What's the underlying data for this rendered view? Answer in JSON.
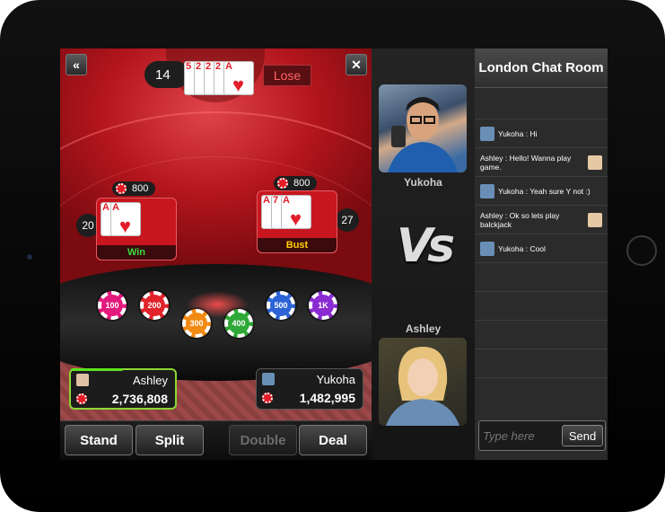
{
  "game": {
    "dealer": {
      "score": "14",
      "result": "Lose",
      "cards": [
        {
          "rank": "5",
          "suit": "♥"
        },
        {
          "rank": "2",
          "suit": "♥"
        },
        {
          "rank": "2",
          "suit": "♥"
        },
        {
          "rank": "2",
          "suit": "♥"
        },
        {
          "rank": "A",
          "suit": "♥"
        }
      ]
    },
    "hands": [
      {
        "bet": "800",
        "score": "20",
        "result": "Win",
        "result_color": "#3fdc3f",
        "cards": [
          {
            "rank": "A",
            "suit": "♥"
          },
          {
            "rank": "A",
            "suit": "♥"
          }
        ]
      },
      {
        "bet": "800",
        "score": "27",
        "result": "Bust",
        "result_color": "#ffd000",
        "cards": [
          {
            "rank": "A",
            "suit": "♥"
          },
          {
            "rank": "7",
            "suit": "♥"
          },
          {
            "rank": "A",
            "suit": "♥"
          }
        ]
      }
    ],
    "chips": [
      {
        "label": "100",
        "color": "#e3197d"
      },
      {
        "label": "200",
        "color": "#e2222a"
      },
      {
        "label": "300",
        "color": "#f28a12"
      },
      {
        "label": "400",
        "color": "#2ea836"
      },
      {
        "label": "500",
        "color": "#2c63d6"
      },
      {
        "label": "1K",
        "color": "#8a2bd1"
      }
    ],
    "players": [
      {
        "name": "Ashley",
        "money": "2,736,808",
        "progress": 0.5
      },
      {
        "name": "Yukoha",
        "money": "1,482,995"
      }
    ],
    "buttons": {
      "stand": "Stand",
      "split": "Split",
      "double": "Double",
      "deal": "Deal"
    },
    "icons": {
      "back": "«",
      "close": "✕"
    }
  },
  "versus": {
    "top_name": "Yukoha",
    "bottom_name": "Ashley",
    "vs_label": "Vs"
  },
  "chat": {
    "title": "London  Chat Room",
    "messages": [
      {
        "text": "Yukoha : Hi",
        "side": "left"
      },
      {
        "text": "Ashley : Hello! Wanna play game.",
        "side": "right"
      },
      {
        "text": "Yukoha : Yeah sure Y not :)",
        "side": "left"
      },
      {
        "text": "Ashley : Ok so lets play balckjack",
        "side": "right"
      },
      {
        "text": "Yukoha : Cool",
        "side": "left"
      }
    ],
    "input_placeholder": "Type here",
    "send_label": "Send"
  }
}
